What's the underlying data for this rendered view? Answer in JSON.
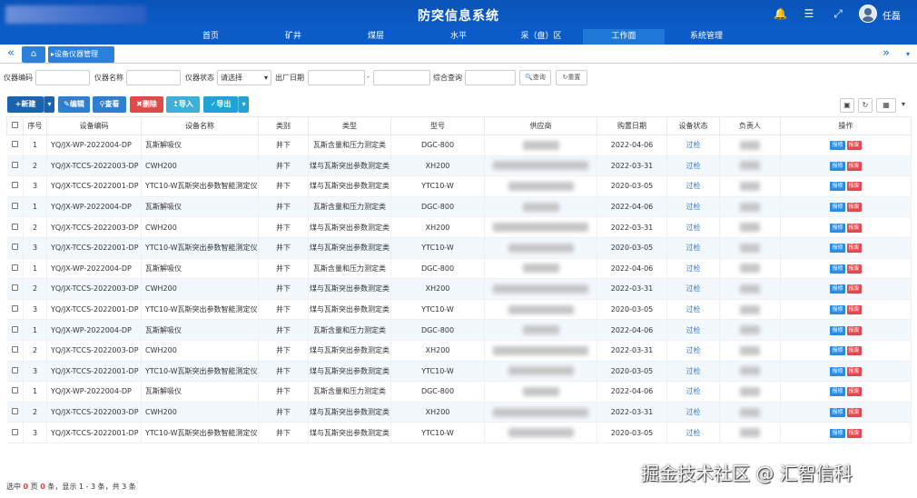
{
  "header": {
    "title": "防突信息系统",
    "user": "任磊"
  },
  "nav": [
    {
      "label": "首页",
      "active": false
    },
    {
      "label": "矿井",
      "active": false
    },
    {
      "label": "煤层",
      "active": false
    },
    {
      "label": "水平",
      "active": false
    },
    {
      "label": "采（盘）区",
      "active": false
    },
    {
      "label": "工作面",
      "active": true
    },
    {
      "label": "系统管理",
      "active": false
    }
  ],
  "tabs": {
    "left_icon": "«",
    "right_icon": "»",
    "drop_icon": "▾",
    "home_icon": "⌂",
    "current": "设备仪器管理"
  },
  "filters": {
    "code_label": "仪器编码",
    "name_label": "仪器名称",
    "status_label": "仪器状态",
    "status_value": "请选择",
    "date_label": "出厂日期",
    "date_sep": "-",
    "query_label": "综合查询",
    "search_btn": "查询",
    "reset_btn": "重置"
  },
  "toolbar": {
    "add": "新建",
    "edit": "编辑",
    "view": "查看",
    "delete": "删除",
    "import": "导入",
    "export": "导出"
  },
  "columns": [
    "序号",
    "设备编码",
    "设备名称",
    "类别",
    "类型",
    "型号",
    "供应商",
    "购置日期",
    "设备状态",
    "负责人",
    "操作"
  ],
  "rows": [
    {
      "no": "1",
      "code": "YQ/JX-WP-2022004-DP",
      "name": "瓦斯解吸仪",
      "cat": "井下",
      "type": "瓦斯含量和压力测定类",
      "model": "DGC-800",
      "date": "2022-04-06",
      "status": "过检",
      "s": "short"
    },
    {
      "no": "2",
      "code": "YQ/JX-TCCS-2022003-DP",
      "name": "CWH200",
      "cat": "井下",
      "type": "煤与瓦斯突出参数测定类",
      "model": "XH200",
      "date": "2022-03-31",
      "status": "过检",
      "s": "long"
    },
    {
      "no": "3",
      "code": "YQ/JX-TCCS-2022001-DP",
      "name": "YTC10-W瓦斯突出参数智能测定仪",
      "cat": "井下",
      "type": "煤与瓦斯突出参数测定类",
      "model": "YTC10-W",
      "date": "2020-03-05",
      "status": "过检",
      "s": "mid"
    },
    {
      "no": "1",
      "code": "YQ/JX-WP-2022004-DP",
      "name": "瓦斯解吸仪",
      "cat": "井下",
      "type": "瓦斯含量和压力测定类",
      "model": "DGC-800",
      "date": "2022-04-06",
      "status": "过检",
      "s": "short"
    },
    {
      "no": "2",
      "code": "YQ/JX-TCCS-2022003-DP",
      "name": "CWH200",
      "cat": "井下",
      "type": "煤与瓦斯突出参数测定类",
      "model": "XH200",
      "date": "2022-03-31",
      "status": "过检",
      "s": "long"
    },
    {
      "no": "3",
      "code": "YQ/JX-TCCS-2022001-DP",
      "name": "YTC10-W瓦斯突出参数智能测定仪",
      "cat": "井下",
      "type": "煤与瓦斯突出参数测定类",
      "model": "YTC10-W",
      "date": "2020-03-05",
      "status": "过检",
      "s": "mid"
    },
    {
      "no": "1",
      "code": "YQ/JX-WP-2022004-DP",
      "name": "瓦斯解吸仪",
      "cat": "井下",
      "type": "瓦斯含量和压力测定类",
      "model": "DGC-800",
      "date": "2022-04-06",
      "status": "过检",
      "s": "short"
    },
    {
      "no": "2",
      "code": "YQ/JX-TCCS-2022003-DP",
      "name": "CWH200",
      "cat": "井下",
      "type": "煤与瓦斯突出参数测定类",
      "model": "XH200",
      "date": "2022-03-31",
      "status": "过检",
      "s": "long"
    },
    {
      "no": "3",
      "code": "YQ/JX-TCCS-2022001-DP",
      "name": "YTC10-W瓦斯突出参数智能测定仪",
      "cat": "井下",
      "type": "煤与瓦斯突出参数测定类",
      "model": "YTC10-W",
      "date": "2020-03-05",
      "status": "过检",
      "s": "mid"
    },
    {
      "no": "1",
      "code": "YQ/JX-WP-2022004-DP",
      "name": "瓦斯解吸仪",
      "cat": "井下",
      "type": "瓦斯含量和压力测定类",
      "model": "DGC-800",
      "date": "2022-04-06",
      "status": "过检",
      "s": "short"
    },
    {
      "no": "2",
      "code": "YQ/JX-TCCS-2022003-DP",
      "name": "CWH200",
      "cat": "井下",
      "type": "煤与瓦斯突出参数测定类",
      "model": "XH200",
      "date": "2022-03-31",
      "status": "过检",
      "s": "long"
    },
    {
      "no": "3",
      "code": "YQ/JX-TCCS-2022001-DP",
      "name": "YTC10-W瓦斯突出参数智能测定仪",
      "cat": "井下",
      "type": "煤与瓦斯突出参数测定类",
      "model": "YTC10-W",
      "date": "2020-03-05",
      "status": "过检",
      "s": "mid"
    },
    {
      "no": "1",
      "code": "YQ/JX-WP-2022004-DP",
      "name": "瓦斯解吸仪",
      "cat": "井下",
      "type": "瓦斯含量和压力测定类",
      "model": "DGC-800",
      "date": "2022-04-06",
      "status": "过检",
      "s": "short"
    },
    {
      "no": "2",
      "code": "YQ/JX-TCCS-2022003-DP",
      "name": "CWH200",
      "cat": "井下",
      "type": "煤与瓦斯突出参数测定类",
      "model": "XH200",
      "date": "2022-03-31",
      "status": "过检",
      "s": "long"
    },
    {
      "no": "3",
      "code": "YQ/JX-TCCS-2022001-DP",
      "name": "YTC10-W瓦斯突出参数智能测定仪",
      "cat": "井下",
      "type": "煤与瓦斯突出参数测定类",
      "model": "YTC10-W",
      "date": "2020-03-05",
      "status": "过检",
      "s": "mid"
    }
  ],
  "ops": {
    "repair": "报修",
    "scrap": "报废"
  },
  "pager": {
    "prefix": "选中",
    "sel": "0",
    "mid": "页",
    "pages": "0",
    "suffix": "条，显示 1 - 3 条，共 3 条"
  },
  "watermark": "掘金技术社区 @ 汇智信科",
  "colors": {
    "header": "#0a53b8",
    "nav_active": "#1f78d8",
    "add": "#1a63b0",
    "edit": "#2f7fd0",
    "delete": "#e04a4a",
    "import": "#3bb0d8",
    "export": "#1fa3d4",
    "link": "#2a7bd6"
  }
}
